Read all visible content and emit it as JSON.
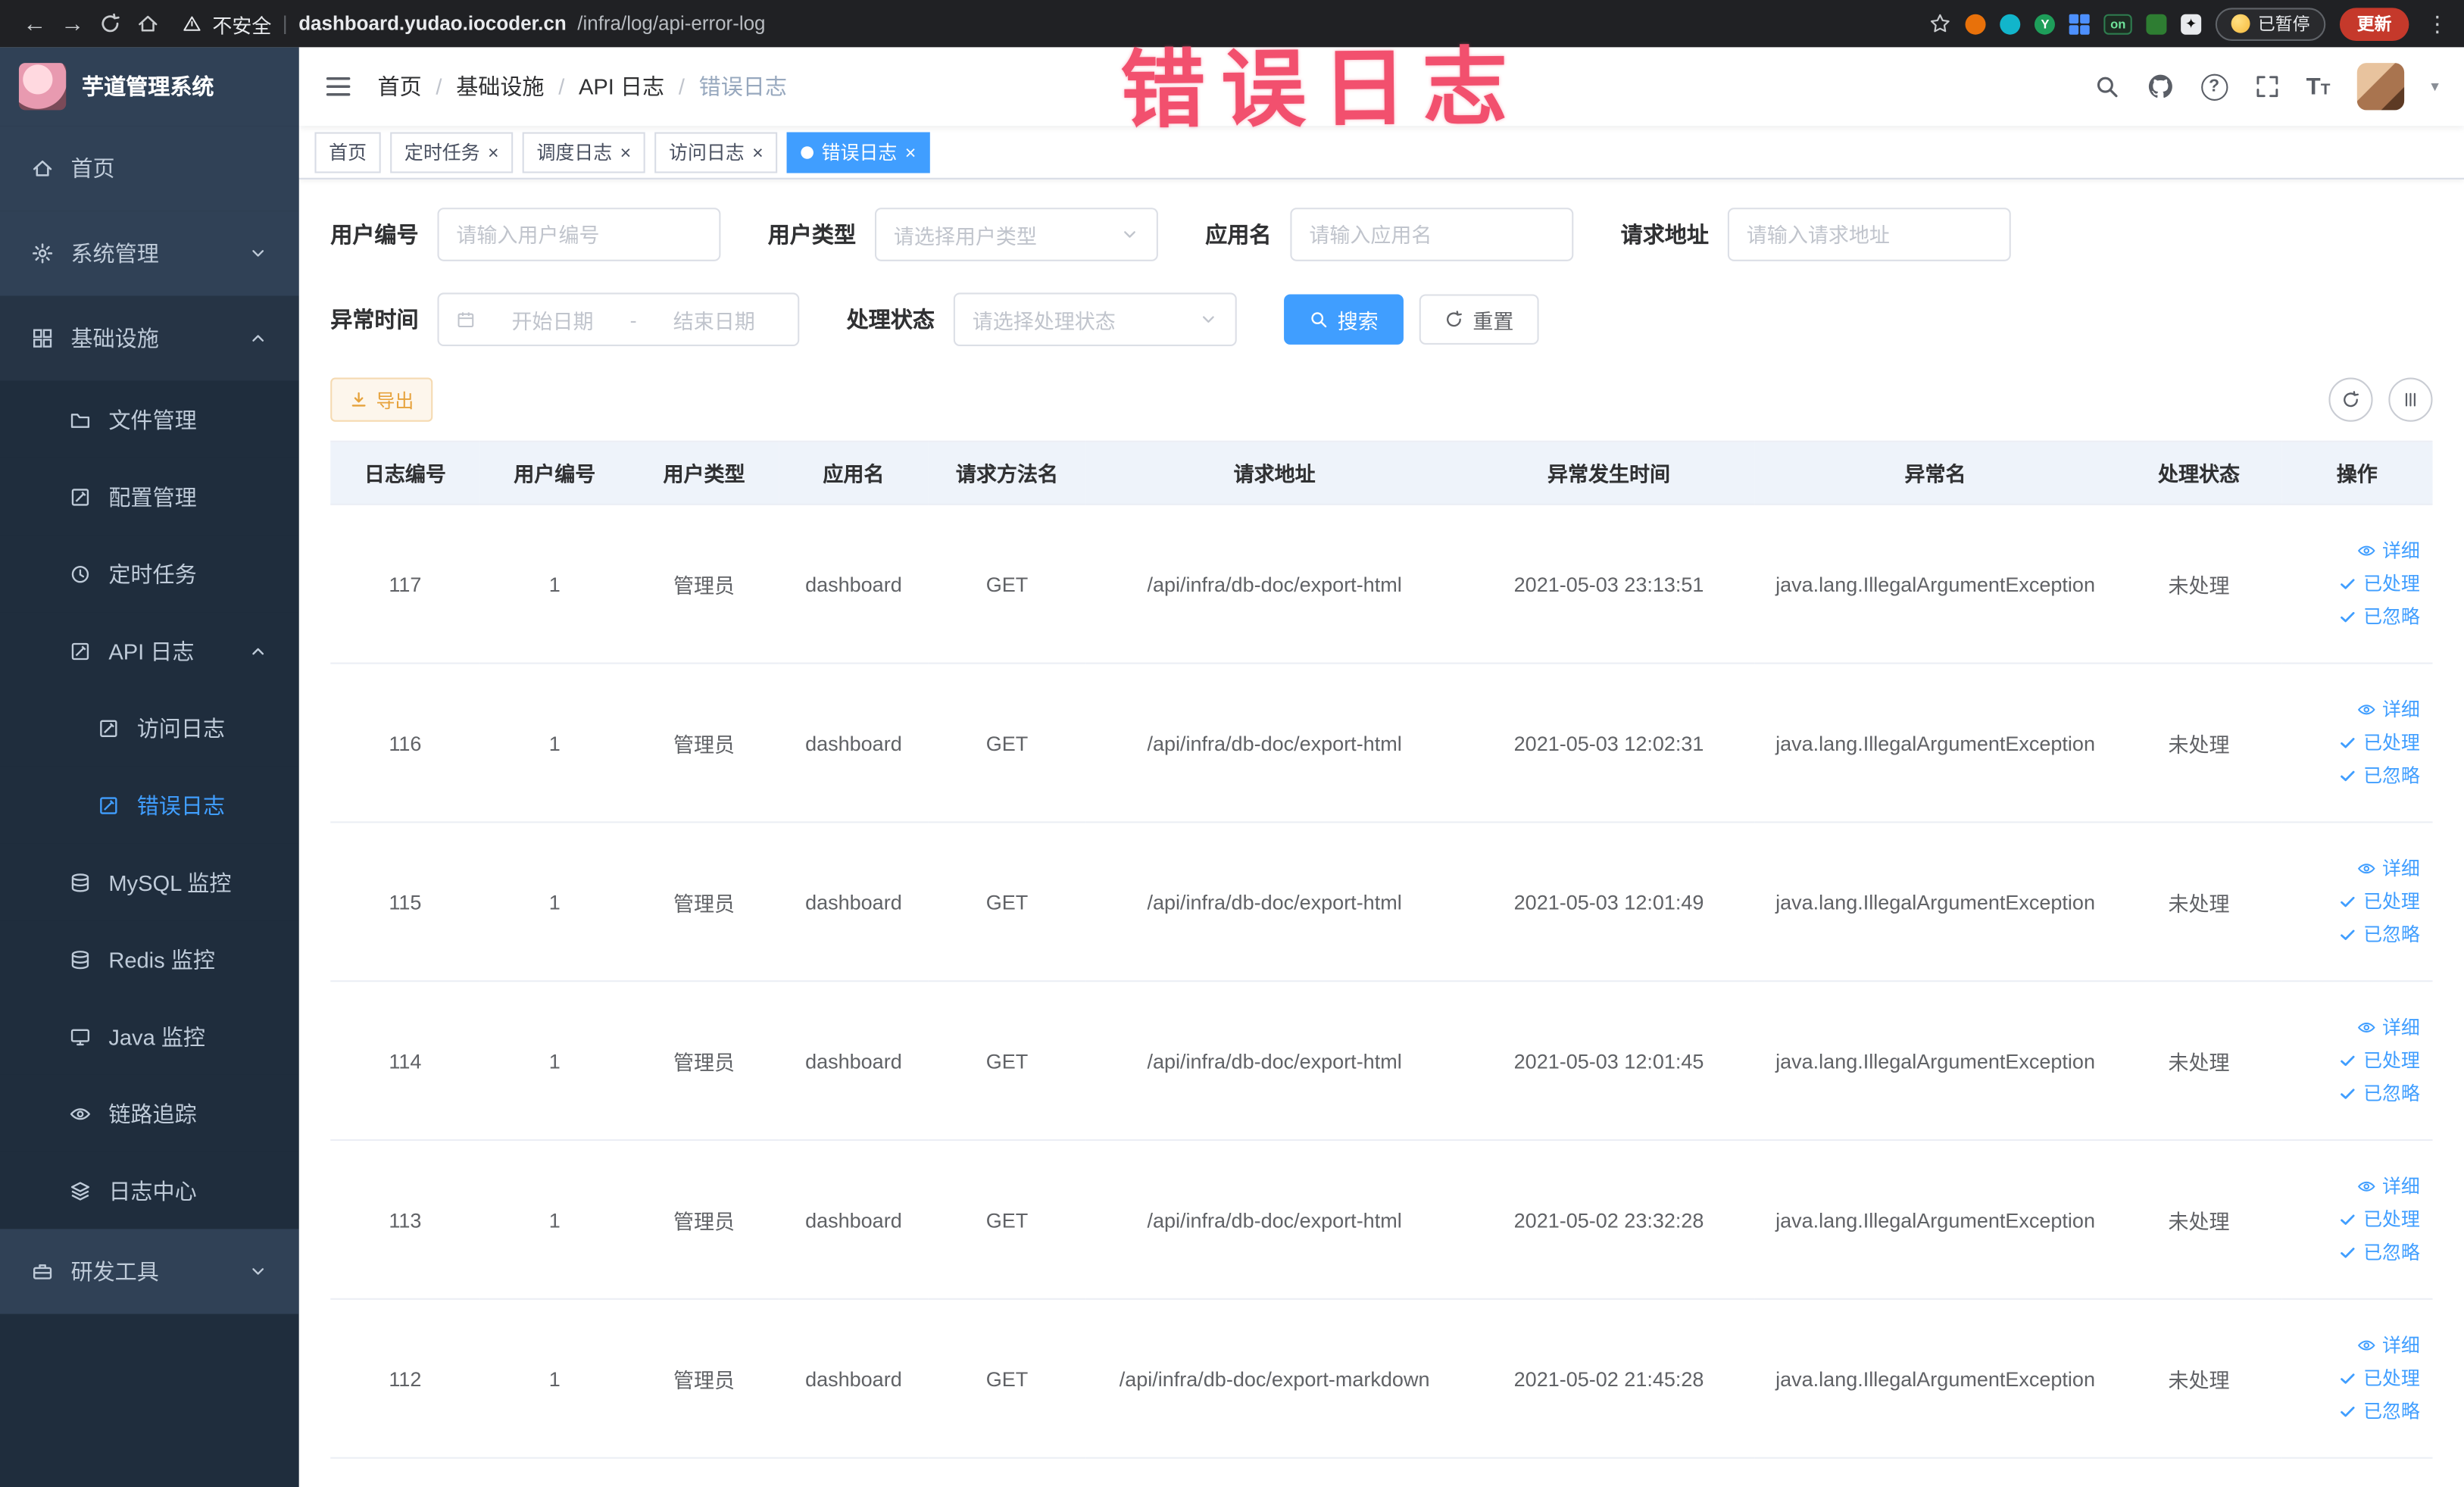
{
  "colors": {
    "accent": "#409eff",
    "annotation": "#f2506e",
    "warning": "#e6a23c",
    "sidebar_bg": "#304156",
    "sidebar_sub_bg": "#1f2d3d"
  },
  "annotation": {
    "text": "错误日志"
  },
  "browser": {
    "security_label": "不安全",
    "url_domain": "dashboard.yudao.iocoder.cn",
    "url_path": "/infra/log/api-error-log",
    "extension_on_badge": "on",
    "paused_badge": "已暂停",
    "update_button": "更新"
  },
  "sidebar": {
    "logo_title": "芋道管理系统",
    "items": [
      {
        "label": "首页"
      },
      {
        "label": "系统管理"
      },
      {
        "label": "基础设施"
      },
      {
        "label": "文件管理"
      },
      {
        "label": "配置管理"
      },
      {
        "label": "定时任务"
      },
      {
        "label": "API 日志"
      },
      {
        "label": "访问日志"
      },
      {
        "label": "错误日志"
      },
      {
        "label": "MySQL 监控"
      },
      {
        "label": "Redis 监控"
      },
      {
        "label": "Java 监控"
      },
      {
        "label": "链路追踪"
      },
      {
        "label": "日志中心"
      },
      {
        "label": "研发工具"
      }
    ]
  },
  "header": {
    "breadcrumb": [
      "首页",
      "基础设施",
      "API 日志",
      "错误日志"
    ],
    "separator": "/"
  },
  "tabs": [
    {
      "label": "首页"
    },
    {
      "label": "定时任务"
    },
    {
      "label": "调度日志"
    },
    {
      "label": "访问日志"
    },
    {
      "label": "错误日志"
    }
  ],
  "filters": {
    "user_id_label": "用户编号",
    "user_id_placeholder": "请输入用户编号",
    "user_type_label": "用户类型",
    "user_type_placeholder": "请选择用户类型",
    "app_name_label": "应用名",
    "app_name_placeholder": "请输入应用名",
    "request_url_label": "请求地址",
    "request_url_placeholder": "请输入请求地址",
    "exception_time_label": "异常时间",
    "date_start_placeholder": "开始日期",
    "date_separator": "-",
    "date_end_placeholder": "结束日期",
    "process_status_label": "处理状态",
    "process_status_placeholder": "请选择处理状态",
    "search_button": "搜索",
    "reset_button": "重置"
  },
  "toolbar": {
    "export_button": "导出"
  },
  "table": {
    "columns": [
      "日志编号",
      "用户编号",
      "用户类型",
      "应用名",
      "请求方法名",
      "请求地址",
      "异常发生时间",
      "异常名",
      "处理状态",
      "操作"
    ],
    "action_labels": {
      "detail": "详细",
      "processed": "已处理",
      "ignored": "已忽略"
    },
    "rows": [
      {
        "id": "117",
        "user_id": "1",
        "user_type": "管理员",
        "app": "dashboard",
        "method": "GET",
        "url": "/api/infra/db-doc/export-html",
        "time": "2021-05-03 23:13:51",
        "exception": "java.lang.IllegalArgumentException",
        "status": "未处理"
      },
      {
        "id": "116",
        "user_id": "1",
        "user_type": "管理员",
        "app": "dashboard",
        "method": "GET",
        "url": "/api/infra/db-doc/export-html",
        "time": "2021-05-03 12:02:31",
        "exception": "java.lang.IllegalArgumentException",
        "status": "未处理"
      },
      {
        "id": "115",
        "user_id": "1",
        "user_type": "管理员",
        "app": "dashboard",
        "method": "GET",
        "url": "/api/infra/db-doc/export-html",
        "time": "2021-05-03 12:01:49",
        "exception": "java.lang.IllegalArgumentException",
        "status": "未处理"
      },
      {
        "id": "114",
        "user_id": "1",
        "user_type": "管理员",
        "app": "dashboard",
        "method": "GET",
        "url": "/api/infra/db-doc/export-html",
        "time": "2021-05-03 12:01:45",
        "exception": "java.lang.IllegalArgumentException",
        "status": "未处理"
      },
      {
        "id": "113",
        "user_id": "1",
        "user_type": "管理员",
        "app": "dashboard",
        "method": "GET",
        "url": "/api/infra/db-doc/export-html",
        "time": "2021-05-02 23:32:28",
        "exception": "java.lang.IllegalArgumentException",
        "status": "未处理"
      },
      {
        "id": "112",
        "user_id": "1",
        "user_type": "管理员",
        "app": "dashboard",
        "method": "GET",
        "url": "/api/infra/db-doc/export-markdown",
        "time": "2021-05-02 21:45:28",
        "exception": "java.lang.IllegalArgumentException",
        "status": "未处理"
      }
    ]
  }
}
